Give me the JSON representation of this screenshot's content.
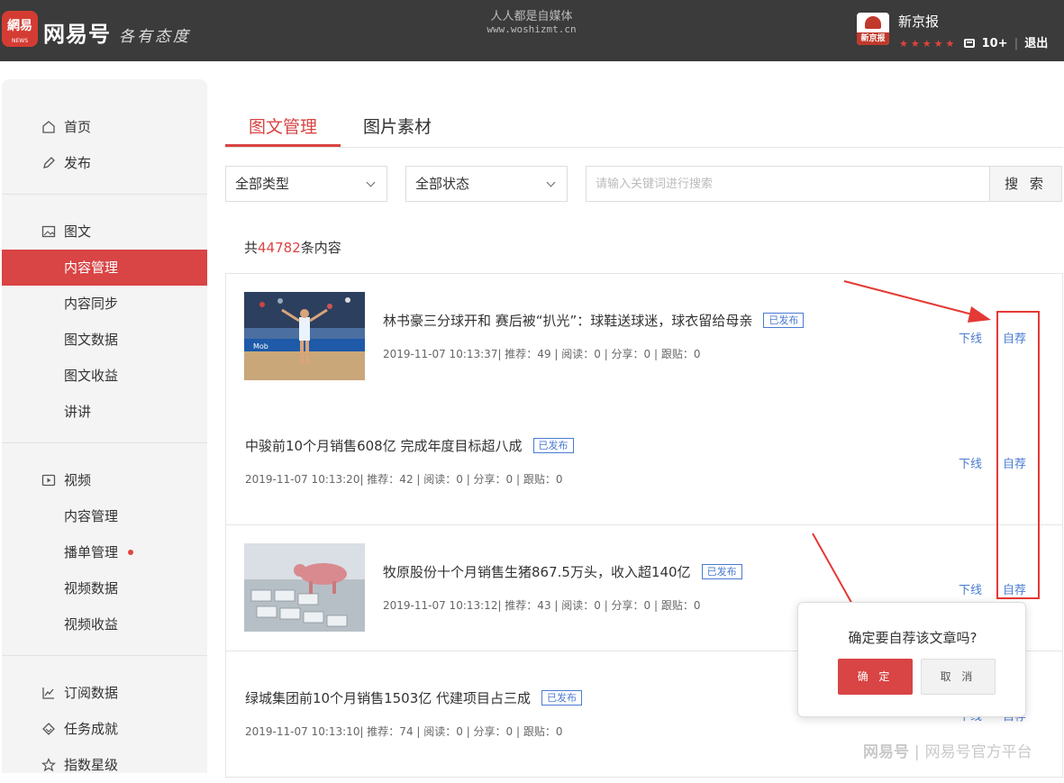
{
  "header": {
    "logo_badge": "網易",
    "logo_badge_sub": "NEWS",
    "logo_text": "网易号",
    "slogan": "各有态度",
    "watermark_line1": "人人都是自媒体",
    "watermark_line2": "www.woshizmt.cn",
    "account_avatar_text": "新京报",
    "account_name": "新京报",
    "stars": "★★★★★",
    "notification_count": "10+",
    "logout": "退出"
  },
  "sidebar": {
    "home": "首页",
    "publish": "发布",
    "article_section": "图文",
    "article_items": [
      "内容管理",
      "内容同步",
      "图文数据",
      "图文收益",
      "讲讲"
    ],
    "video_section": "视频",
    "video_items": [
      "内容管理",
      "播单管理",
      "视频数据",
      "视频收益"
    ],
    "subscription": "订阅数据",
    "tasks": "任务成就",
    "index_level": "指数星级"
  },
  "tabs": [
    "图文管理",
    "图片素材"
  ],
  "filters": {
    "type_select": "全部类型",
    "status_select": "全部状态",
    "search_placeholder": "请输入关键词进行搜索",
    "search_button": "搜 索"
  },
  "summary": {
    "prefix": "共",
    "count": "44782",
    "suffix": "条内容"
  },
  "articles": [
    {
      "title": "林书豪三分球开和 赛后被“扒光”：球鞋送球迷，球衣留给母亲",
      "status": "已发布",
      "meta": "2019-11-07 10:13:37| 推荐：49 | 阅读：0 | 分享：0 | 跟贴：0",
      "offline": "下线",
      "recommend": "自荐"
    },
    {
      "title": "中骏前10个月销售608亿 完成年度目标超八成",
      "status": "已发布",
      "meta": "2019-11-07 10:13:20| 推荐：42 | 阅读：0 | 分享：0 | 跟贴：0",
      "offline": "下线",
      "recommend": "自荐"
    },
    {
      "title": "牧原股份十个月销售生猪867.5万头，收入超140亿",
      "status": "已发布",
      "meta": "2019-11-07 10:13:12| 推荐：43 | 阅读：0 | 分享：0 | 跟贴：0",
      "offline": "下线",
      "recommend": "自荐"
    },
    {
      "title": "绿城集团前10个月销售1503亿 代建项目占三成",
      "status": "已发布",
      "meta": "2019-11-07 10:13:10| 推荐：74 | 阅读：0 | 分享：0 | 跟贴：0",
      "offline": "下线",
      "recommend": "自荐"
    }
  ],
  "confirm_popup": {
    "question": "确定要自荐该文章吗?",
    "ok": "确 定",
    "cancel": "取 消"
  },
  "bottom_watermark": {
    "brand": "网易号",
    "divider": "|",
    "text": "网易号官方平台"
  },
  "colors": {
    "topbar": "#3b3b3b",
    "accent_red": "#d94444",
    "link_blue": "#4a7bd0",
    "annotation_red": "#e53935"
  }
}
